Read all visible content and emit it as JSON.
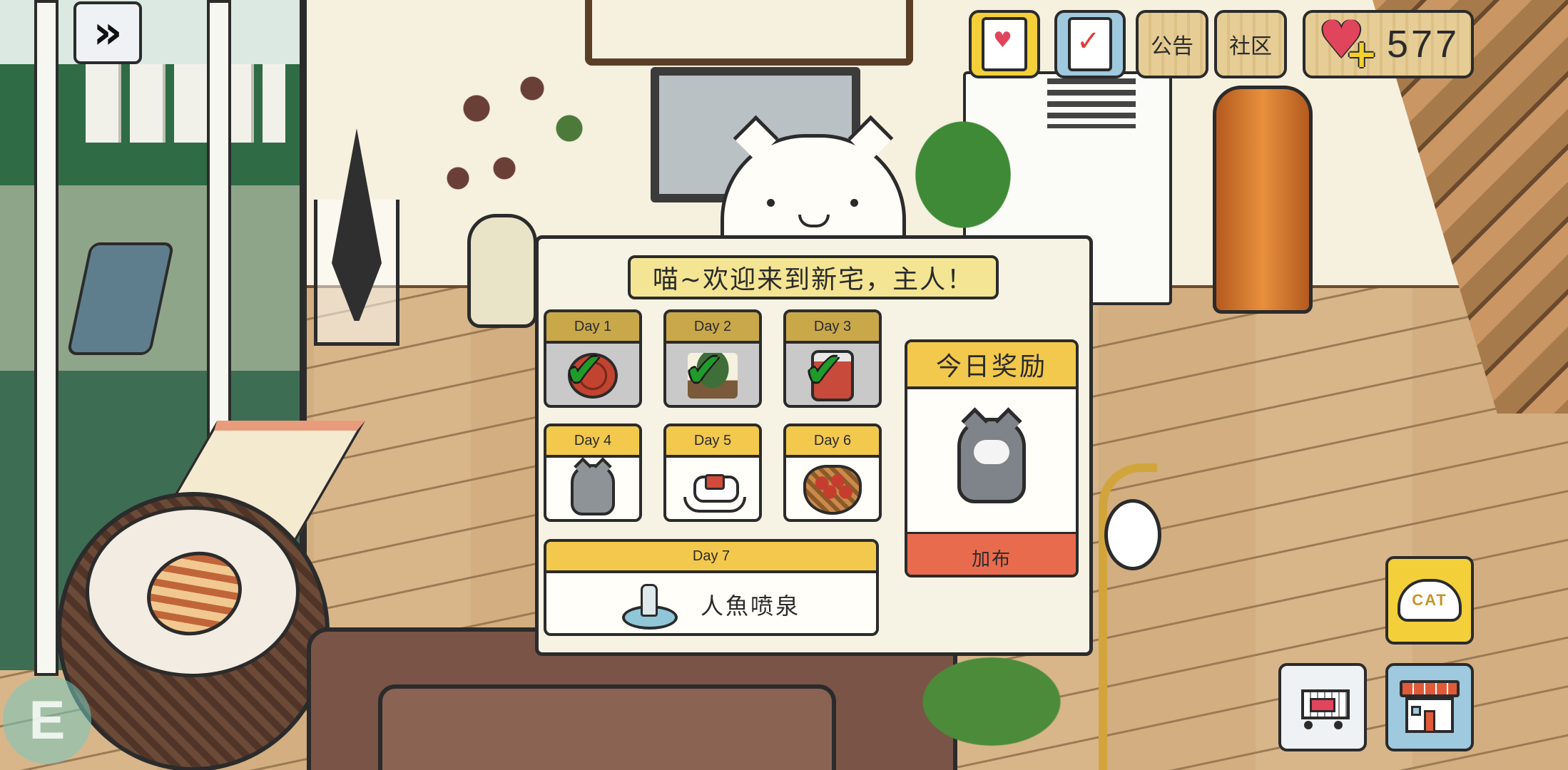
{
  "hud": {
    "fast_forward_icon": "double-chevron-right",
    "catbook_icon": "cat-book",
    "catbook_label": "CAT",
    "tasks_icon": "clipboard-check",
    "notice_label": "公告",
    "community_label": "社区",
    "hearts_icon": "heart-plus",
    "hearts_count": "577"
  },
  "dialog": {
    "title": "喵~欢迎来到新宅，主人！",
    "days": [
      {
        "label": "Day 1",
        "item_icon": "jam-tart",
        "claimed": true
      },
      {
        "label": "Day 2",
        "item_icon": "bonsai",
        "claimed": true
      },
      {
        "label": "Day 3",
        "item_icon": "jar",
        "claimed": true
      },
      {
        "label": "Day 4",
        "item_icon": "grey-cat",
        "claimed": false
      },
      {
        "label": "Day 5",
        "item_icon": "rocking-horse",
        "claimed": false
      },
      {
        "label": "Day 6",
        "item_icon": "fruit-basket",
        "claimed": false
      }
    ],
    "day7": {
      "label": "Day 7",
      "item_icon": "mermaid-fountain",
      "item_name": "人魚喷泉"
    },
    "today": {
      "title": "今日奖励",
      "reward_icon": "grey-cat",
      "claim_label": "加布"
    }
  },
  "bottom": {
    "food_label": "CAT",
    "food_icon": "cat-food-bowl",
    "shop_icon": "shopping-cart",
    "yard_icon": "house",
    "corner_letter": "E"
  },
  "colors": {
    "accent_yellow": "#f2c94c",
    "claim_button": "#e96b4e",
    "check_green": "#1f9a2b",
    "heart_red": "#e0455c"
  }
}
